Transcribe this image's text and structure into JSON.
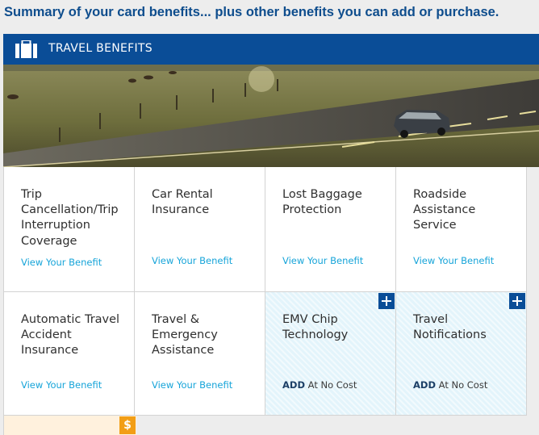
{
  "page": {
    "summary_title": "Summary of your card benefits... plus other benefits you can add or purchase."
  },
  "section": {
    "icon": "briefcase-icon",
    "label": "TRAVEL BENEFITS"
  },
  "banner": {
    "image": "car-on-country-road-photo"
  },
  "benefits": [
    {
      "title": "Trip Cancellation/Trip Interruption Coverage",
      "link": "View Your Benefit"
    },
    {
      "title": "Car Rental Insurance",
      "link": "View Your Benefit"
    },
    {
      "title": "Lost Baggage Protection",
      "link": "View Your Benefit"
    },
    {
      "title": "Roadside Assistance Service",
      "link": "View Your Benefit"
    },
    {
      "title": "Automatic Travel Accident Insurance",
      "link": "View Your Benefit"
    },
    {
      "title": "Travel & Emergency Assistance",
      "link": "View Your Benefit"
    },
    {
      "title": "EMV Chip Technology",
      "add_word": "ADD",
      "add_note": " At No Cost",
      "button_icon": "plus-icon"
    },
    {
      "title": "Travel Notifications",
      "add_word": "ADD",
      "add_note": " At No Cost",
      "button_icon": "plus-icon"
    }
  ],
  "partial_tile": {
    "badge": "$",
    "badge_icon": "dollar-icon"
  },
  "colors": {
    "title_blue": "#0e4d8d",
    "header_blue": "#0a4d97",
    "link_blue": "#16a4d9",
    "addable_tile_bg": "#e3f4fb",
    "purchase_badge": "#f29e16"
  }
}
